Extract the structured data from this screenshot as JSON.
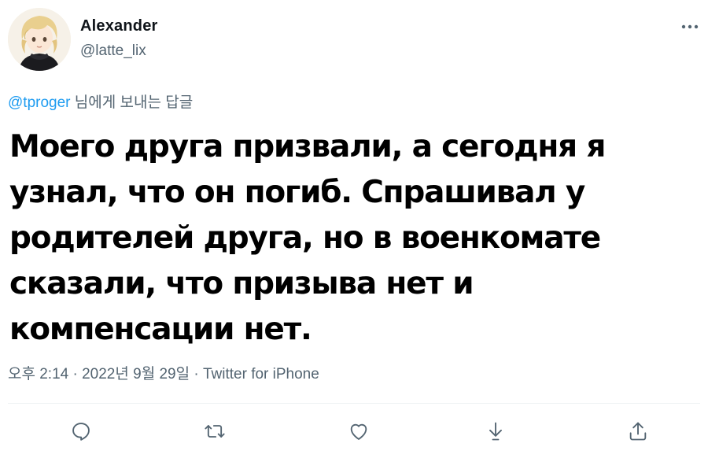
{
  "author": {
    "name": "Alexander",
    "handle": "@latte_lix"
  },
  "reply_context": {
    "mention": "@tproger",
    "suffix": " 님에게 보내는 답글"
  },
  "tweet": {
    "lines": [
      "Моего друга призвали, а сегодня я",
      "узнал, что он погиб. Спрашивал у",
      "родителей друга, но в военкомате",
      "сказали, что призыва нет и",
      "компенсации нет."
    ]
  },
  "meta": {
    "time": "오후 2:14",
    "separator": " · ",
    "date": "2022년 9월 29일",
    "source": "Twitter for iPhone"
  },
  "actions": {
    "icons": [
      "reply-icon",
      "retweet-icon",
      "like-icon",
      "bookmark-icon",
      "share-icon"
    ]
  },
  "colors": {
    "text": "#0f1419",
    "secondary": "#536471",
    "accent": "#1d9bf0",
    "divider": "#eff3f4"
  }
}
